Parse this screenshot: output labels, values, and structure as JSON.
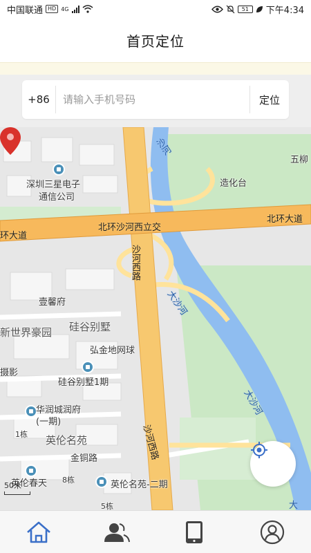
{
  "status_bar": {
    "carrier": "中国联通",
    "hd_badge": "HD",
    "network": "4G",
    "battery": "51",
    "time": "下午4:34"
  },
  "header": {
    "title": "首页定位"
  },
  "search": {
    "country_code": "+86",
    "placeholder": "请输入手机号码",
    "value": "",
    "locate_label": "定位"
  },
  "map": {
    "labels": [
      "深圳三星电子",
      "通信公司",
      "造化台",
      "五柳",
      "北环沙河西立交",
      "北环大道",
      "环大道",
      "沙河",
      "沙河西路",
      "大沙河",
      "壹馨府",
      "新世界豪园",
      "硅谷别墅",
      "弘金地网球",
      "摄影",
      "硅谷别墅1期",
      "华润城润府",
      "(一期)",
      "1栋",
      "英伦名苑",
      "金铜路",
      "英伦春天",
      "8栋",
      "英伦名苑-二期",
      "5栋",
      "沙河西路",
      "大沙河",
      "大"
    ],
    "scale": "50米"
  },
  "colors": {
    "arterial": "#f7b95c",
    "road": "#ffe39b",
    "river": "#8fbdf0",
    "park": "#cbe8c5",
    "pin": "#d9322b",
    "fab_icon": "#3a6fc8"
  },
  "nav": {
    "items": [
      {
        "name": "home",
        "active": true
      },
      {
        "name": "contacts",
        "active": false
      },
      {
        "name": "device",
        "active": false
      },
      {
        "name": "profile",
        "active": false
      }
    ]
  }
}
